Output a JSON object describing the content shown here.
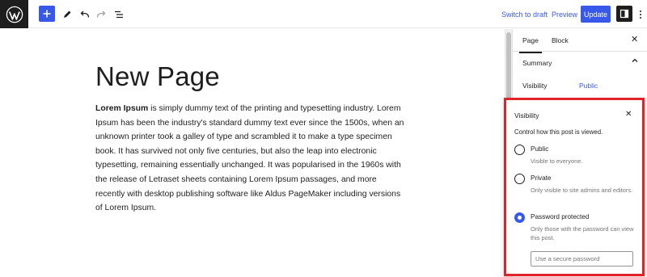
{
  "toolbar": {
    "logo_icon": "wordpress-icon",
    "add_icon": "plus-icon",
    "tools_icon": "pencil-icon",
    "undo_icon": "undo-icon",
    "redo_icon": "redo-icon",
    "list_view_icon": "list-view-icon",
    "switch_to_draft_label": "Switch to draft",
    "preview_label": "Preview",
    "update_label": "Update",
    "settings_icon": "sidebar-icon",
    "options_icon": "more-vertical-icon"
  },
  "editor": {
    "title": "New Page",
    "body_bold": "Lorem Ipsum",
    "body_text": " is simply dummy text of the printing and typesetting industry. Lorem Ipsum has been the industry's standard dummy text ever since the 1500s, when an unknown printer took a galley of type and scrambled it to make a type specimen book. It has survived not only five centuries, but also the leap into electronic typesetting, remaining essentially unchanged. It was popularised in the 1960s with the release of Letraset sheets containing Lorem Ipsum passages, and more recently with desktop publishing software like Aldus PageMaker including versions of Lorem Ipsum."
  },
  "sidebar": {
    "tabs": [
      {
        "label": "Page",
        "active": true
      },
      {
        "label": "Block",
        "active": false
      }
    ],
    "close_label": "✕",
    "summary_title": "Summary",
    "visibility_label": "Visibility",
    "visibility_value": "Public"
  },
  "visibility_popover": {
    "title": "Visibility",
    "close_label": "✕",
    "description": "Control how this post is viewed.",
    "options": [
      {
        "label": "Public",
        "help": "Visible to everyone.",
        "checked": false
      },
      {
        "label": "Private",
        "help": "Only visible to site admins and editors.",
        "checked": false
      },
      {
        "label": "Password protected",
        "help": "Only those with the password can view this post.",
        "checked": true
      }
    ],
    "password_placeholder": "Use a secure password",
    "password_value": ""
  },
  "colors": {
    "accent": "#3858e9",
    "highlight_border": "#e32228",
    "dark": "#1e1e1e"
  }
}
